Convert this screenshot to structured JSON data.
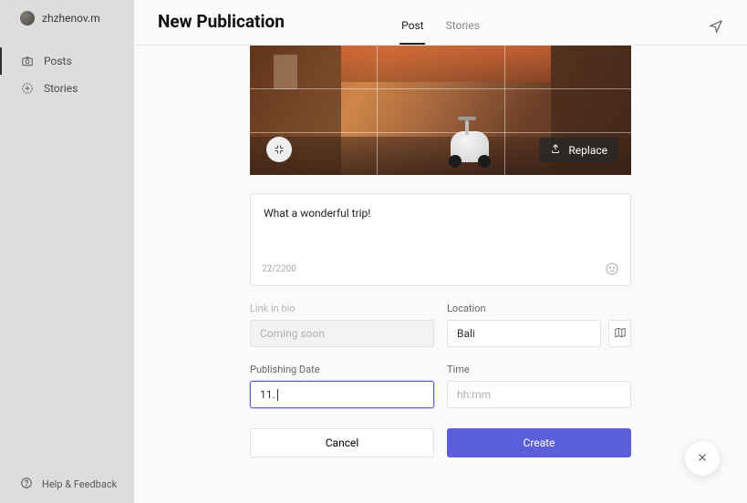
{
  "user": {
    "name": "zhzhenov.m"
  },
  "nav": {
    "posts": "Posts",
    "stories": "Stories",
    "help": "Help & Feedback"
  },
  "header": {
    "title": "New Publication",
    "tab_post": "Post",
    "tab_stories": "Stories"
  },
  "image": {
    "replace_label": "Replace"
  },
  "caption": {
    "text": "What a wonderful trip!",
    "counter": "22/2200"
  },
  "fields": {
    "link_label": "Link in bio",
    "link_placeholder": "Coming soon",
    "location_label": "Location",
    "location_value": "Bali",
    "date_label": "Publishing Date",
    "date_value": "11.",
    "time_label": "Time",
    "time_placeholder": "hh:mm"
  },
  "buttons": {
    "cancel": "Cancel",
    "create": "Create"
  }
}
